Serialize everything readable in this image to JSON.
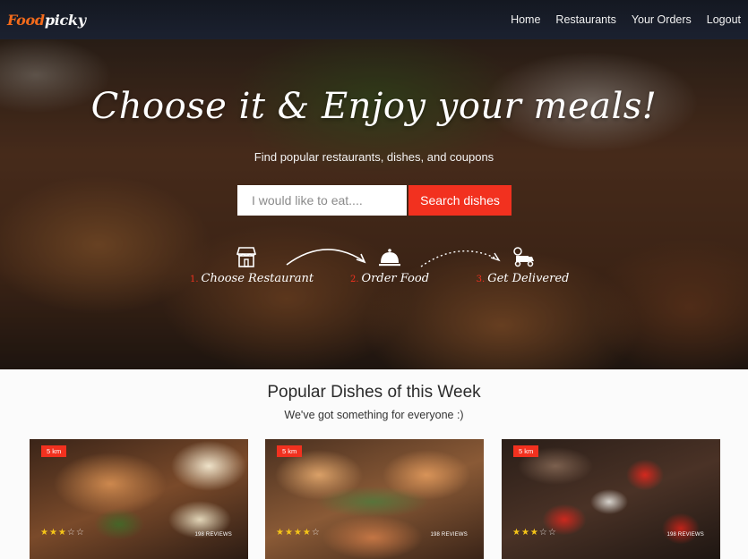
{
  "brand": {
    "part1": "Food",
    "part2": "picky"
  },
  "nav": [
    {
      "label": "Home"
    },
    {
      "label": "Restaurants"
    },
    {
      "label": "Your Orders"
    },
    {
      "label": "Logout"
    }
  ],
  "hero": {
    "headline": "Choose it & Enjoy your meals!",
    "subline": "Find popular restaurants, dishes, and coupons",
    "search_placeholder": "I would like to eat....",
    "search_button": "Search dishes",
    "steps": [
      {
        "number": "1.",
        "label": "Choose Restaurant",
        "icon": "store-icon"
      },
      {
        "number": "2.",
        "label": "Order Food",
        "icon": "cloche-icon"
      },
      {
        "number": "3.",
        "label": "Get Delivered",
        "icon": "delivery-scooter-icon"
      }
    ]
  },
  "popular": {
    "title": "Popular Dishes of this Week",
    "subtitle": "We've got something for everyone :)",
    "cards": [
      {
        "distance": "5 km",
        "rating": 3,
        "reviews": "198 REVIEWS"
      },
      {
        "distance": "5 km",
        "rating": 4,
        "reviews": "198 REVIEWS"
      },
      {
        "distance": "5 km",
        "rating": 3,
        "reviews": "198 REVIEWS"
      }
    ]
  },
  "colors": {
    "accent": "#f2311f",
    "brand_orange": "#f26a1b",
    "navbar": "#171c27"
  }
}
